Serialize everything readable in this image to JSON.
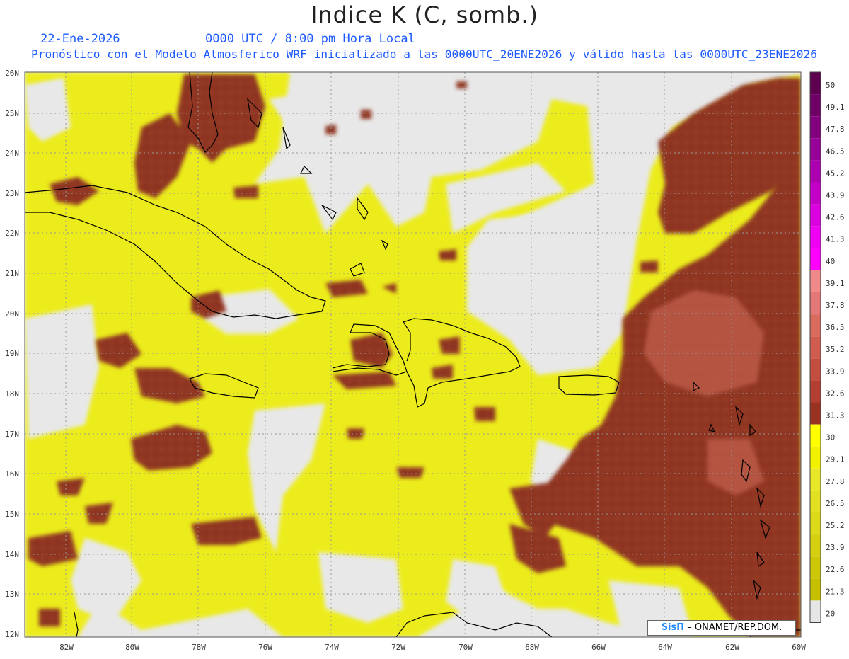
{
  "header": {
    "title": "Indice K (C, somb.)",
    "date": "22-Ene-2026",
    "time": "0000 UTC / 8:00 pm Hora Local",
    "description": "Pronóstico con el Modelo Atmosferico WRF inicializado a las 0000UTC_20ENE2026 y válido hasta las  0000UTC_23ENE2026"
  },
  "map": {
    "lat_labels": [
      "26N",
      "25N",
      "24N",
      "23N",
      "22N",
      "21N",
      "20N",
      "19N",
      "18N",
      "17N",
      "16N",
      "15N",
      "14N",
      "13N",
      "12N"
    ],
    "lon_labels": [
      "82W",
      "80W",
      "78W",
      "76W",
      "74W",
      "72W",
      "70W",
      "68W",
      "66W",
      "64W",
      "62W",
      "60W"
    ],
    "lon_range": [
      -83.2,
      -60
    ],
    "lat_range": [
      11.9,
      26.1
    ],
    "background_color": "#e8e8e8",
    "land_outline_color": "#000000"
  },
  "colorbar": {
    "labels": [
      "50",
      "49.1",
      "47.8",
      "46.5",
      "45.2",
      "43.9",
      "42.6",
      "41.3",
      "40",
      "39.1",
      "37.8",
      "36.5",
      "35.2",
      "33.9",
      "32.6",
      "31.3",
      "30",
      "29.1",
      "27.8",
      "26.5",
      "25.2",
      "23.9",
      "22.6",
      "21.3",
      "20"
    ],
    "colors": [
      "#5c004f",
      "#6e0066",
      "#82007d",
      "#970096",
      "#ad00b0",
      "#c400c8",
      "#db00e0",
      "#ef00f2",
      "#ff00ff",
      "#f08a8a",
      "#e47777",
      "#d96a5e",
      "#cf5c4f",
      "#c34e40",
      "#b23f31",
      "#9a3222",
      "#ffff00",
      "#f2f200",
      "#e8e829",
      "#e2e020",
      "#dcd918",
      "#d4d010",
      "#ccc808",
      "#c6c000",
      "#e6e6e6"
    ]
  },
  "attribution": {
    "brand": "SisΠ",
    "text": "– ONAMET/REP.DOM."
  }
}
